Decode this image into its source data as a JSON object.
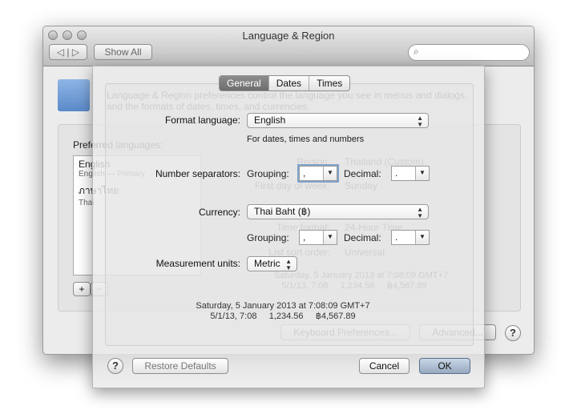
{
  "window": {
    "title": "Language & Region",
    "show_all": "Show All",
    "search_placeholder": ""
  },
  "background": {
    "description": "Language & Region preferences control the language you see in menus and dialogs,",
    "description2": "and the formats of dates, times, and currencies.",
    "preferred_label": "Preferred languages:",
    "languages": [
      {
        "name": "English",
        "sub": "English — Primary"
      },
      {
        "name": "ภาษาไทย",
        "sub": "Thai"
      }
    ],
    "region_label": "Region:",
    "region_value": "Thailand (Custom)",
    "first_day_label": "First day of week:",
    "first_day_value": "Sunday",
    "time_format_label": "Time format:",
    "time_format_value": "24-Hour Time",
    "sort_label": "List sort order:",
    "sort_value": "Universal",
    "sample1": "Saturday, 5 January 2013 at 7:08:09 GMT+7",
    "sample2": "5/1/13, 7:08     1,234.56     ฿4,567.89",
    "keyboard_button": "Keyboard Preferences...",
    "advanced_button": "Advanced...",
    "add": "+",
    "remove": "−",
    "help": "?"
  },
  "sheet": {
    "tabs": [
      {
        "label": "General",
        "selected": true
      },
      {
        "label": "Dates"
      },
      {
        "label": "Times"
      }
    ],
    "format_language_label": "Format language:",
    "format_language_value": "English",
    "format_hint": "For dates, times and numbers",
    "number_separators_label": "Number separators:",
    "grouping_label": "Grouping:",
    "decimal_label": "Decimal:",
    "number_grouping": ",",
    "number_decimal": ".",
    "currency_label": "Currency:",
    "currency_value": "Thai Baht (฿)",
    "currency_grouping": ",",
    "currency_decimal": ".",
    "measurement_label": "Measurement units:",
    "measurement_value": "Metric",
    "sample_line1": "Saturday, 5 January 2013 at 7:08:09 GMT+7",
    "sample_line2": "5/1/13, 7:08     1,234.56     ฿4,567.89",
    "help": "?",
    "restore": "Restore Defaults",
    "cancel": "Cancel",
    "ok": "OK"
  }
}
